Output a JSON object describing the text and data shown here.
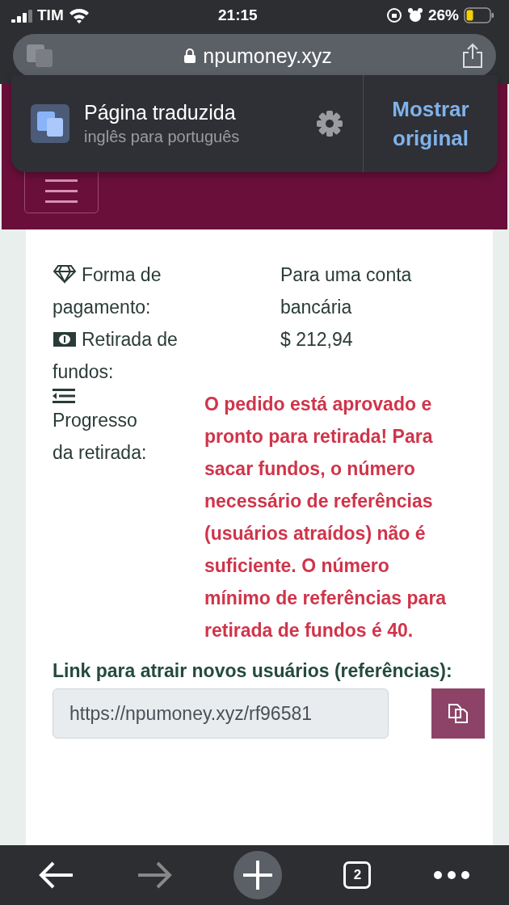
{
  "status_bar": {
    "carrier": "TIM",
    "time": "21:15",
    "battery": "26%"
  },
  "url_bar": {
    "domain": "npumoney.xyz"
  },
  "translate_popup": {
    "title": "Página traduzida",
    "subtitle": "inglês para português",
    "action": "Mostrar original"
  },
  "details": [
    {
      "kind": "text",
      "label": "Forma de pagamento:",
      "value": "Para uma conta bancária"
    },
    {
      "kind": "text",
      "label": "Retirada de fundos:",
      "value": "$ 212,94"
    },
    {
      "kind": "status",
      "label": "Progresso da retirada:",
      "value": "O pedido está aprovado e pronto para retirada! Para sacar fundos, o número necessário de referências (usuários atraídos) não é suficiente. O número mínimo de referências para retirada de fundos é 40."
    }
  ],
  "referral": {
    "heading": "Link para atrair novos usuários (referências):",
    "value": "https://npumoney.xyz/rf96581"
  },
  "toolbar": {
    "back_disabled": false,
    "forward_disabled": true,
    "tabs_count": "2"
  }
}
